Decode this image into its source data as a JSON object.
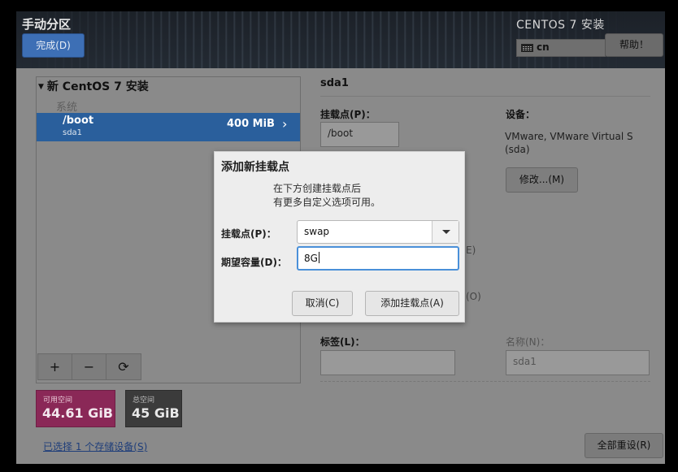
{
  "header": {
    "title": "手动分区",
    "done_label": "完成(D)",
    "product": "CENTOS 7 安装",
    "keyboard_layout": "cn",
    "help_label": "帮助！"
  },
  "left_panel": {
    "install_title": "新 CentOS 7 安装",
    "system_label": "系统",
    "selected_partition": {
      "mount": "/boot",
      "device": "sda1",
      "size": "400 MiB"
    },
    "toolbar": {
      "add": "+",
      "remove": "−",
      "refresh": "⟳"
    },
    "available_label": "可用空间",
    "available_value": "44.61 GiB",
    "total_label": "总空间",
    "total_value": "45 GiB",
    "storage_link": "已选择 1 个存储设备(S)"
  },
  "right_panel": {
    "title": "sda1",
    "mount_label": "挂载点(P)：",
    "mount_value": "/boot",
    "device_label": "设备：",
    "device_value_line1": "VMware, VMware Virtual S",
    "device_value_line2": "(sda)",
    "modify_label": "修改...(M)",
    "partial_e": "E)",
    "partial_o": "(O)",
    "tag_label": "标签(L)：",
    "tag_value": "",
    "name_label": "名称(N)：",
    "name_value": "sda1",
    "reset_label": "全部重设(R)"
  },
  "dialog": {
    "title": "添加新挂载点",
    "message_line1": "在下方创建挂载点后",
    "message_line2": "有更多自定义选项可用。",
    "mount_label": "挂载点(P)：",
    "mount_value": "swap",
    "capacity_label": "期望容量(D)：",
    "capacity_value": "8G",
    "cancel_label": "取消(C)",
    "add_label": "添加挂载点(A)"
  },
  "colors": {
    "accent_blue": "#2a5f9c",
    "available_magenta": "#8a2857",
    "total_dark": "#3b3b3b",
    "focus_blue": "#4a90d9"
  }
}
